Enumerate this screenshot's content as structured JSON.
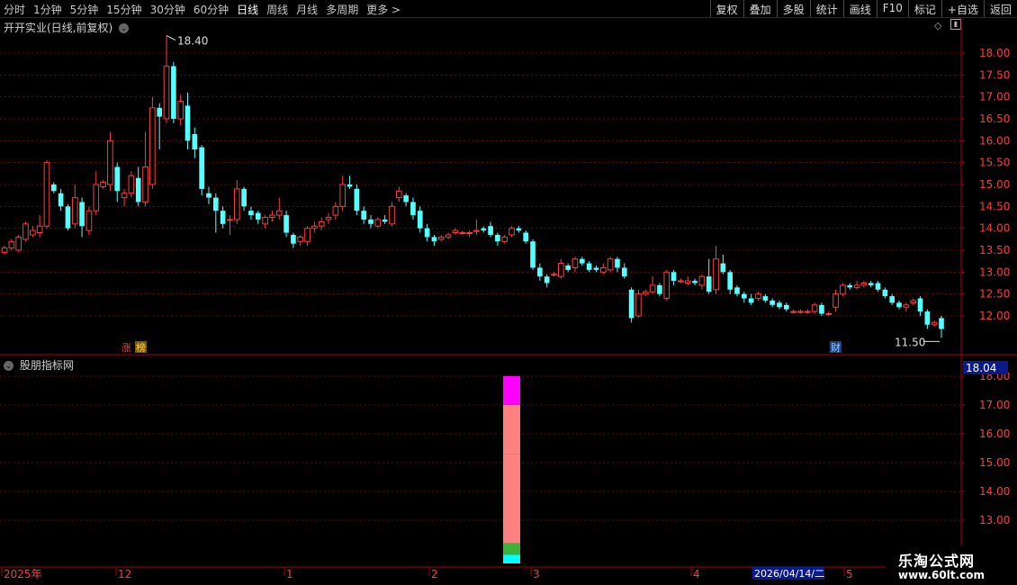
{
  "toolbar": {
    "periods": [
      "分时",
      "1分钟",
      "5分钟",
      "15分钟",
      "30分钟",
      "60分钟",
      "日线",
      "周线",
      "月线",
      "多周期",
      "更多 >"
    ],
    "active_period": "日线",
    "buttons": [
      "复权",
      "叠加",
      "多股",
      "统计",
      "画线",
      "F10",
      "标记",
      "+自选",
      "返回"
    ]
  },
  "main_title": "开开实业(日线,前复权)",
  "sub_title": "股朋指标网",
  "max_label": "18.40",
  "min_label": "11.50",
  "price_axis": [
    "18.00",
    "17.50",
    "17.00",
    "16.50",
    "16.00",
    "15.50",
    "15.00",
    "14.50",
    "14.00",
    "13.50",
    "13.00",
    "12.50",
    "12.00"
  ],
  "sub_axis": [
    "18.00",
    "17.00",
    "16.00",
    "15.00",
    "14.00",
    "13.00"
  ],
  "sub_current_value": "18.04",
  "markers": {
    "zhang": "涨",
    "bang": "榜",
    "cai": "财"
  },
  "time_axis": [
    "2025年",
    "12",
    "1",
    "2",
    "3",
    "4",
    "5"
  ],
  "cursor_date": "2026/04/14/二",
  "watermark": {
    "line1": "乐淘公式网",
    "line2": "www.60lt.com"
  },
  "colors": {
    "up": "#ff3c3c",
    "down": "#54ffff",
    "grid": "#7a0000",
    "axis": "#b00000",
    "magenta": "#ff00ff",
    "pink": "#ff8080",
    "green": "#3cb43c",
    "cyan": "#00ffff"
  },
  "chart_data": {
    "type": "candlestick",
    "ylim": [
      11.3,
      18.8
    ],
    "candles": [
      [
        13.45,
        13.55,
        13.4,
        13.6
      ],
      [
        13.55,
        13.7,
        13.5,
        13.75
      ],
      [
        13.5,
        13.8,
        13.45,
        13.85
      ],
      [
        13.75,
        14.1,
        13.7,
        14.15
      ],
      [
        13.85,
        13.95,
        13.8,
        14.05
      ],
      [
        13.9,
        14.05,
        13.8,
        14.3
      ],
      [
        14.05,
        15.5,
        14.0,
        15.55
      ],
      [
        15.0,
        14.85,
        14.8,
        15.05
      ],
      [
        14.8,
        14.5,
        14.4,
        14.9
      ],
      [
        14.5,
        14.0,
        13.95,
        14.55
      ],
      [
        14.1,
        14.7,
        14.0,
        15.0
      ],
      [
        14.6,
        14.05,
        13.8,
        14.7
      ],
      [
        13.95,
        14.4,
        13.85,
        14.5
      ],
      [
        14.4,
        15.0,
        14.3,
        15.3
      ],
      [
        14.95,
        15.05,
        14.9,
        15.1
      ],
      [
        15.0,
        16.0,
        14.85,
        16.2
      ],
      [
        15.4,
        14.85,
        14.6,
        15.5
      ],
      [
        14.7,
        14.8,
        14.5,
        14.9
      ],
      [
        14.8,
        15.2,
        14.7,
        15.3
      ],
      [
        15.15,
        14.6,
        14.5,
        15.4
      ],
      [
        14.6,
        15.4,
        14.5,
        16.2
      ],
      [
        15.0,
        16.75,
        14.9,
        17.0
      ],
      [
        16.75,
        16.55,
        15.8,
        16.85
      ],
      [
        16.5,
        17.7,
        16.4,
        18.4
      ],
      [
        17.7,
        16.5,
        16.4,
        17.8
      ],
      [
        16.5,
        16.9,
        16.35,
        17.05
      ],
      [
        16.8,
        16.0,
        15.8,
        17.1
      ],
      [
        16.15,
        15.8,
        15.6,
        16.3
      ],
      [
        15.85,
        14.9,
        14.75,
        15.9
      ],
      [
        14.8,
        14.7,
        14.55,
        14.95
      ],
      [
        14.7,
        14.4,
        13.9,
        14.8
      ],
      [
        14.4,
        14.1,
        14.0,
        14.5
      ],
      [
        14.2,
        14.2,
        13.85,
        14.3
      ],
      [
        14.2,
        14.9,
        14.1,
        15.1
      ],
      [
        14.9,
        14.5,
        14.4,
        14.95
      ],
      [
        14.4,
        14.3,
        14.2,
        14.5
      ],
      [
        14.35,
        14.2,
        14.1,
        14.4
      ],
      [
        14.1,
        14.25,
        14.0,
        14.3
      ],
      [
        14.25,
        14.3,
        14.15,
        14.4
      ],
      [
        14.3,
        14.4,
        14.2,
        14.7
      ],
      [
        14.3,
        13.9,
        13.8,
        14.4
      ],
      [
        13.85,
        13.65,
        13.55,
        13.9
      ],
      [
        13.7,
        13.8,
        13.6,
        13.85
      ],
      [
        13.7,
        14.0,
        13.6,
        14.05
      ],
      [
        14.0,
        14.05,
        13.9,
        14.15
      ],
      [
        14.05,
        14.15,
        13.95,
        14.25
      ],
      [
        14.2,
        14.25,
        14.1,
        14.35
      ],
      [
        14.3,
        14.5,
        14.2,
        14.6
      ],
      [
        14.5,
        15.0,
        14.4,
        15.2
      ],
      [
        15.0,
        14.95,
        14.9,
        15.2
      ],
      [
        14.9,
        14.4,
        14.3,
        15.0
      ],
      [
        14.4,
        14.2,
        14.1,
        14.5
      ],
      [
        14.2,
        14.1,
        14.0,
        14.3
      ],
      [
        14.05,
        14.2,
        14.0,
        14.25
      ],
      [
        14.2,
        14.15,
        14.1,
        14.3
      ],
      [
        14.1,
        14.5,
        14.05,
        14.6
      ],
      [
        14.7,
        14.85,
        14.6,
        14.95
      ],
      [
        14.75,
        14.6,
        14.5,
        14.8
      ],
      [
        14.6,
        14.3,
        14.2,
        14.7
      ],
      [
        14.4,
        14.0,
        13.9,
        14.5
      ],
      [
        14.0,
        13.8,
        13.7,
        14.1
      ],
      [
        13.8,
        13.7,
        13.6,
        13.85
      ],
      [
        13.75,
        13.8,
        13.7,
        13.85
      ],
      [
        13.8,
        13.85,
        13.75,
        13.9
      ],
      [
        13.9,
        13.95,
        13.85,
        14.0
      ],
      [
        13.9,
        13.9,
        13.85,
        13.95
      ],
      [
        13.9,
        13.9,
        13.8,
        13.95
      ],
      [
        13.95,
        13.95,
        13.85,
        14.2
      ],
      [
        14.0,
        13.95,
        13.9,
        14.05
      ],
      [
        14.05,
        13.85,
        13.8,
        14.15
      ],
      [
        13.85,
        13.7,
        13.6,
        13.9
      ],
      [
        13.7,
        13.8,
        13.65,
        13.85
      ],
      [
        13.85,
        14.0,
        13.8,
        14.05
      ],
      [
        14.0,
        13.95,
        13.9,
        14.05
      ],
      [
        13.9,
        13.7,
        13.65,
        13.95
      ],
      [
        13.7,
        13.1,
        13.05,
        13.75
      ],
      [
        13.1,
        12.9,
        12.8,
        13.2
      ],
      [
        12.9,
        12.75,
        12.65,
        12.95
      ],
      [
        12.95,
        12.95,
        12.9,
        13.0
      ],
      [
        12.9,
        13.2,
        12.85,
        13.3
      ],
      [
        13.15,
        13.05,
        13.0,
        13.2
      ],
      [
        13.1,
        13.3,
        13.0,
        13.35
      ],
      [
        13.3,
        13.2,
        13.15,
        13.35
      ],
      [
        13.2,
        13.05,
        13.0,
        13.25
      ],
      [
        13.1,
        13.05,
        13.0,
        13.15
      ],
      [
        13.0,
        13.1,
        12.95,
        13.2
      ],
      [
        13.05,
        13.3,
        13.0,
        13.35
      ],
      [
        13.3,
        13.1,
        13.0,
        13.35
      ],
      [
        13.1,
        12.9,
        12.85,
        13.2
      ],
      [
        12.6,
        11.95,
        11.85,
        12.65
      ],
      [
        12.0,
        12.5,
        11.95,
        12.6
      ],
      [
        12.5,
        12.55,
        12.45,
        12.6
      ],
      [
        12.55,
        12.7,
        12.5,
        12.9
      ],
      [
        12.7,
        12.5,
        12.45,
        12.75
      ],
      [
        12.4,
        13.0,
        12.35,
        13.05
      ],
      [
        13.0,
        12.8,
        12.7,
        13.05
      ],
      [
        12.8,
        12.8,
        12.75,
        12.85
      ],
      [
        12.75,
        12.8,
        12.7,
        12.9
      ],
      [
        12.8,
        12.75,
        12.7,
        12.85
      ],
      [
        12.7,
        12.9,
        12.6,
        12.95
      ],
      [
        12.9,
        12.55,
        12.5,
        13.3
      ],
      [
        12.6,
        13.3,
        12.5,
        13.6
      ],
      [
        13.2,
        13.0,
        12.95,
        13.4
      ],
      [
        13.0,
        12.6,
        12.5,
        13.05
      ],
      [
        12.65,
        12.5,
        12.45,
        12.7
      ],
      [
        12.5,
        12.4,
        12.3,
        12.55
      ],
      [
        12.4,
        12.3,
        12.25,
        12.5
      ],
      [
        12.4,
        12.5,
        12.35,
        12.55
      ],
      [
        12.45,
        12.35,
        12.3,
        12.5
      ],
      [
        12.35,
        12.25,
        12.2,
        12.4
      ],
      [
        12.3,
        12.2,
        12.15,
        12.35
      ],
      [
        12.25,
        12.15,
        12.1,
        12.3
      ],
      [
        12.1,
        12.1,
        12.05,
        12.15
      ],
      [
        12.1,
        12.1,
        12.05,
        12.15
      ],
      [
        12.1,
        12.1,
        12.05,
        12.15
      ],
      [
        12.1,
        12.25,
        12.05,
        12.3
      ],
      [
        12.25,
        12.05,
        12.0,
        12.3
      ],
      [
        12.05,
        12.05,
        12.0,
        12.1
      ],
      [
        12.2,
        12.5,
        12.1,
        12.6
      ],
      [
        12.5,
        12.7,
        12.45,
        12.75
      ],
      [
        12.7,
        12.65,
        12.6,
        12.75
      ],
      [
        12.65,
        12.7,
        12.6,
        12.8
      ],
      [
        12.7,
        12.75,
        12.65,
        12.8
      ],
      [
        12.75,
        12.7,
        12.65,
        12.8
      ],
      [
        12.75,
        12.6,
        12.55,
        12.8
      ],
      [
        12.6,
        12.45,
        12.4,
        12.65
      ],
      [
        12.45,
        12.3,
        12.25,
        12.5
      ],
      [
        12.3,
        12.2,
        12.15,
        12.35
      ],
      [
        12.2,
        12.25,
        12.1,
        12.3
      ],
      [
        12.3,
        12.35,
        12.25,
        12.4
      ],
      [
        12.4,
        12.1,
        12.0,
        12.45
      ],
      [
        12.1,
        11.8,
        11.7,
        12.15
      ],
      [
        11.8,
        11.85,
        11.75,
        11.9
      ],
      [
        11.95,
        11.7,
        11.5,
        12.0
      ]
    ],
    "indicator": {
      "segments": [
        {
          "from": 18.0,
          "to": 17.0,
          "color": "magenta"
        },
        {
          "from": 17.0,
          "to": 15.3,
          "color": "pink"
        },
        {
          "from": 15.3,
          "to": 12.2,
          "color": "pink"
        },
        {
          "from": 12.2,
          "to": 11.8,
          "color": "green"
        },
        {
          "from": 11.8,
          "to": 11.5,
          "color": "cyan"
        }
      ]
    }
  }
}
